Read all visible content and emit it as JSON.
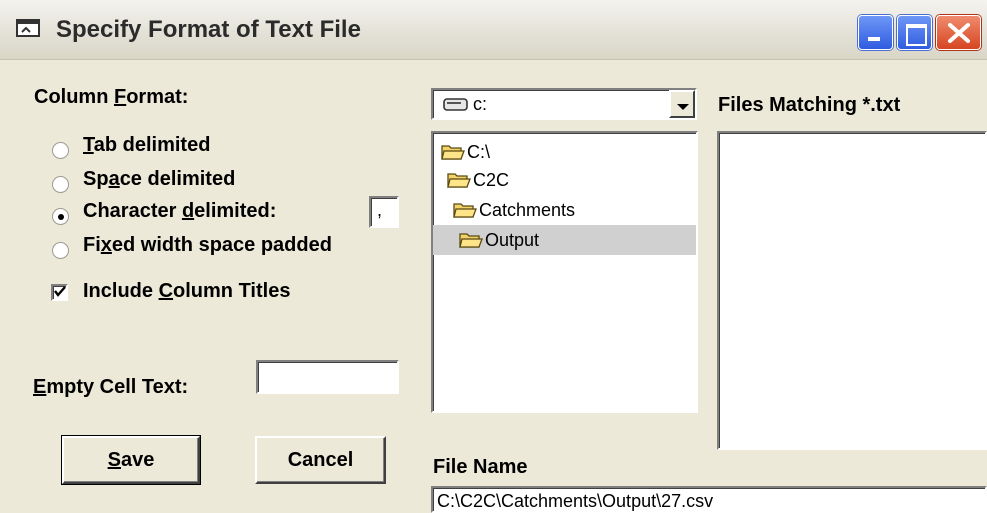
{
  "window": {
    "title": "Specify Format of Text File"
  },
  "column_format": {
    "label_prefix": "Column ",
    "label_accel": "F",
    "label_suffix": "ormat:",
    "options": [
      {
        "pre": "",
        "accel": "T",
        "post": "ab delimited",
        "checked": false
      },
      {
        "pre": "Sp",
        "accel": "a",
        "post": "ce delimited",
        "checked": false
      },
      {
        "pre": "Character ",
        "accel": "d",
        "post": "elimited:",
        "checked": true
      },
      {
        "pre": "Fi",
        "accel": "x",
        "post": "ed width space padded",
        "checked": false
      }
    ],
    "delimiter_value": ","
  },
  "include_titles": {
    "pre": "Include ",
    "accel": "C",
    "post": "olumn Titles",
    "checked": true
  },
  "empty_cell": {
    "accel": "E",
    "post": "mpty Cell Text:",
    "value": ""
  },
  "buttons": {
    "save_accel": "S",
    "save_post": "ave",
    "cancel": "Cancel"
  },
  "drive": {
    "value": "c:"
  },
  "folders": [
    {
      "name": "C:\\",
      "indent": 0,
      "selected": false
    },
    {
      "name": "C2C",
      "indent": 1,
      "selected": false
    },
    {
      "name": "Catchments",
      "indent": 2,
      "selected": false
    },
    {
      "name": "Output",
      "indent": 3,
      "selected": true
    }
  ],
  "files": {
    "label": "Files Matching *.txt",
    "items": []
  },
  "file_name": {
    "label": "File Name",
    "value": "C:\\C2C\\Catchments\\Output\\27.csv"
  },
  "colors": {
    "dialog_bg": "#ECE9D8",
    "titlebar_bg": "#E4E2D8",
    "close_button": "#D64522",
    "control_buttons": "#2F5CE0",
    "selected_folder_bg": "#D0D0D0"
  }
}
